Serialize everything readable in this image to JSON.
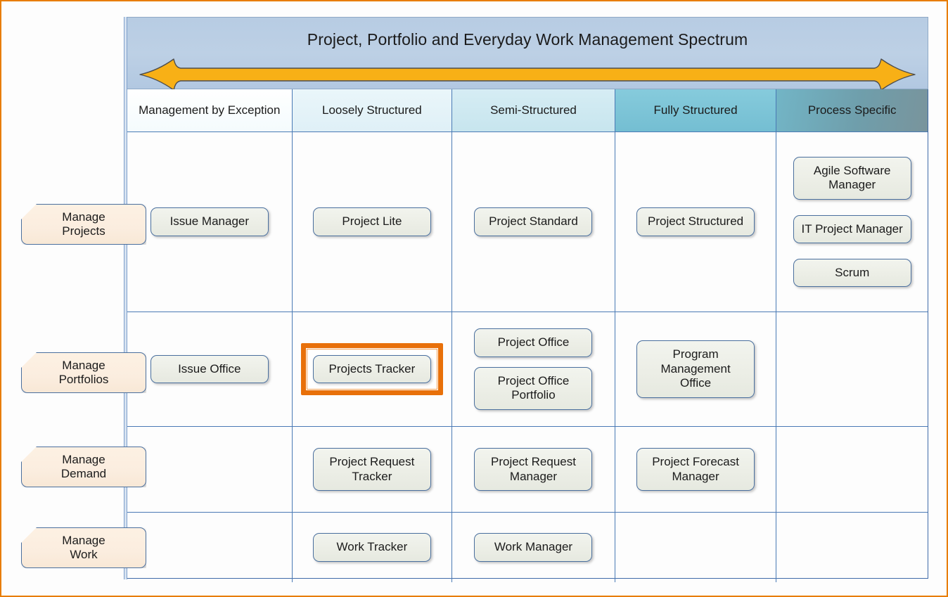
{
  "page": {
    "border_color": "#e87d00",
    "background": "#fdfdfd"
  },
  "header": {
    "title": "Project, Portfolio and Everyday Work Management Spectrum",
    "arrow": {
      "name": "double-headed-arrow",
      "color": "#f8b016",
      "stroke": "#4a4a4a",
      "direction": "both"
    },
    "band_color": "#b7cce3"
  },
  "matrix": {
    "columns": [
      {
        "label": "Management by\nException",
        "color": "#f7fcfd"
      },
      {
        "label": "Loosely Structured",
        "color": "#e3f2f8"
      },
      {
        "label": "Semi-Structured",
        "color": "#cde9f1"
      },
      {
        "label": "Fully Structured",
        "color": "#7ec7da"
      },
      {
        "label": "Process Specific",
        "color": "#6f9eab"
      }
    ],
    "rows": [
      {
        "label": "Manage\nProjects",
        "cells": [
          [
            "Issue Manager"
          ],
          [
            "Project Lite"
          ],
          [
            "Project Standard"
          ],
          [
            "Project Structured"
          ],
          [
            "Agile Software\nManager",
            "IT Project Manager",
            "Scrum"
          ]
        ]
      },
      {
        "label": "Manage\nPortfolios",
        "cells": [
          [
            "Issue Office"
          ],
          [
            "Projects Tracker"
          ],
          [
            "Project Office",
            "Project Office\nPortfolio"
          ],
          [
            "Program\nManagement\nOffice"
          ],
          []
        ]
      },
      {
        "label": "Manage\nDemand",
        "cells": [
          [],
          [
            "Project Request\nTracker"
          ],
          [
            "Project Request\nManager"
          ],
          [
            "Project Forecast\nManager"
          ],
          []
        ]
      },
      {
        "label": "Manage\nWork",
        "cells": [
          [],
          [
            "Work Tracker"
          ],
          [
            "Work Manager"
          ],
          [],
          []
        ]
      }
    ],
    "highlighted_item": "Projects Tracker",
    "highlight_color": "#e8700a",
    "grid_line_color": "#4a7ab5",
    "item_box_fill": "#eceee6",
    "item_box_border": "#4a6f9e",
    "row_label_fill": "#fbeddf"
  }
}
